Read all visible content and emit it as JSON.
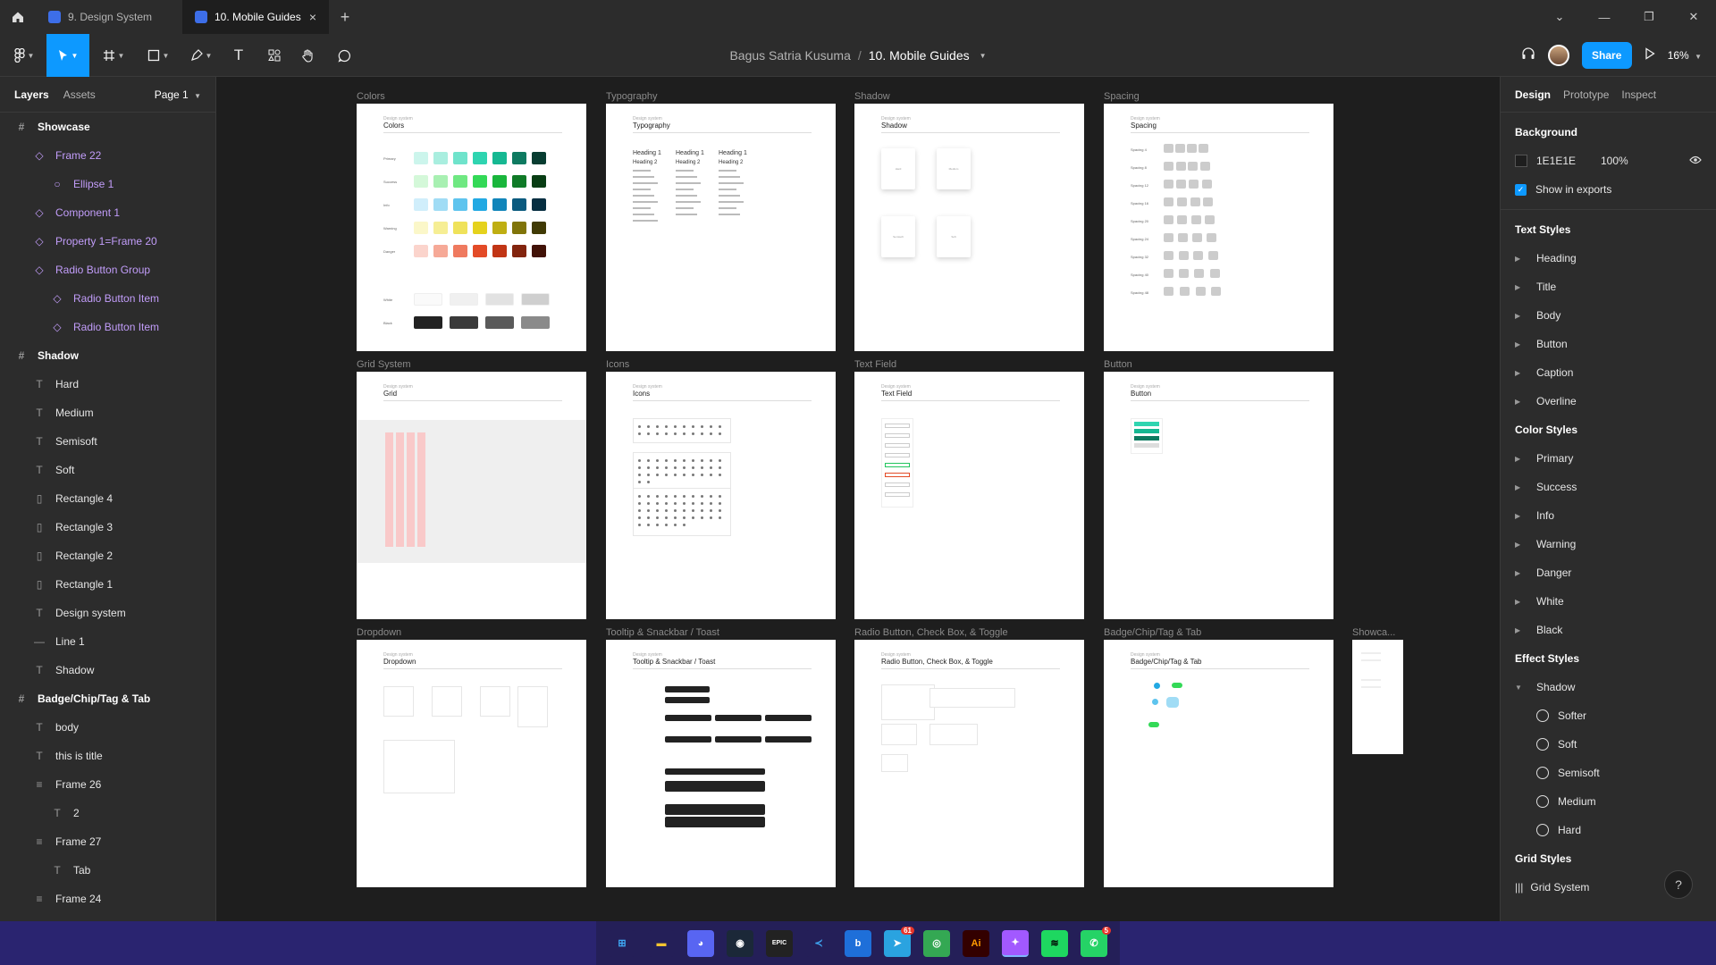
{
  "titlebar": {
    "tabs": [
      {
        "label": "9. Design System"
      },
      {
        "label": "10. Mobile Guides"
      }
    ],
    "add_tab": "+",
    "window_controls": [
      "chevron-down",
      "minimize",
      "restore",
      "close"
    ]
  },
  "toolbar": {
    "tools": [
      "main-menu",
      "move",
      "frame",
      "shape",
      "pen",
      "text",
      "resources",
      "hand",
      "comment"
    ],
    "breadcrumb": {
      "owner": "Bagus Satria Kusuma",
      "separator": "/",
      "file": "10. Mobile Guides"
    },
    "share_label": "Share",
    "zoom": "16%"
  },
  "left_panel": {
    "tabs": [
      "Layers",
      "Assets"
    ],
    "page": "Page 1",
    "layers": [
      {
        "name": "Showcase",
        "type": "frame",
        "indent": 0,
        "bold": true
      },
      {
        "name": "Frame 22",
        "type": "component",
        "indent": 1
      },
      {
        "name": "Ellipse 1",
        "type": "ellipse-comp",
        "indent": 2
      },
      {
        "name": "Component 1",
        "type": "component",
        "indent": 1
      },
      {
        "name": "Property 1=Frame 20",
        "type": "component",
        "indent": 1
      },
      {
        "name": "Radio Button Group",
        "type": "component",
        "indent": 1
      },
      {
        "name": "Radio Button Item",
        "type": "component",
        "indent": 2
      },
      {
        "name": "Radio Button Item",
        "type": "component",
        "indent": 2
      },
      {
        "name": "Shadow",
        "type": "frame",
        "indent": 0,
        "bold": true
      },
      {
        "name": "Hard",
        "type": "text",
        "indent": 1
      },
      {
        "name": "Medium",
        "type": "text",
        "indent": 1
      },
      {
        "name": "Semisoft",
        "type": "text",
        "indent": 1
      },
      {
        "name": "Soft",
        "type": "text",
        "indent": 1
      },
      {
        "name": "Rectangle 4",
        "type": "rect",
        "indent": 1
      },
      {
        "name": "Rectangle 3",
        "type": "rect",
        "indent": 1
      },
      {
        "name": "Rectangle 2",
        "type": "rect",
        "indent": 1
      },
      {
        "name": "Rectangle 1",
        "type": "rect",
        "indent": 1
      },
      {
        "name": "Design system",
        "type": "text",
        "indent": 1
      },
      {
        "name": "Line 1",
        "type": "line",
        "indent": 1
      },
      {
        "name": "Shadow",
        "type": "text",
        "indent": 1
      },
      {
        "name": "Badge/Chip/Tag & Tab",
        "type": "frame",
        "indent": 0,
        "bold": true
      },
      {
        "name": "body",
        "type": "text",
        "indent": 1
      },
      {
        "name": "this is title",
        "type": "text",
        "indent": 1
      },
      {
        "name": "Frame 26",
        "type": "autolayout",
        "indent": 1
      },
      {
        "name": "2",
        "type": "text",
        "indent": 2
      },
      {
        "name": "Frame 27",
        "type": "autolayout",
        "indent": 1
      },
      {
        "name": "Tab",
        "type": "text",
        "indent": 2
      },
      {
        "name": "Frame 24",
        "type": "autolayout",
        "indent": 1
      }
    ]
  },
  "right_panel": {
    "tabs": [
      "Design",
      "Prototype",
      "Inspect"
    ],
    "background": {
      "title": "Background",
      "hex": "1E1E1E",
      "opacity": "100%",
      "show_in_exports": "Show in exports"
    },
    "text_styles": {
      "title": "Text Styles",
      "items": [
        "Heading",
        "Title",
        "Body",
        "Button",
        "Caption",
        "Overline"
      ]
    },
    "color_styles": {
      "title": "Color Styles",
      "items": [
        "Primary",
        "Success",
        "Info",
        "Warning",
        "Danger",
        "White",
        "Black"
      ]
    },
    "effect_styles": {
      "title": "Effect Styles",
      "group": "Shadow",
      "items": [
        "Softer",
        "Soft",
        "Semisoft",
        "Medium",
        "Hard"
      ]
    },
    "grid_styles": {
      "title": "Grid Styles",
      "item": "Grid System"
    },
    "help": "?"
  },
  "canvas": {
    "frames": [
      {
        "label": "Colors",
        "title": "Colors"
      },
      {
        "label": "Typography",
        "title": "Typography"
      },
      {
        "label": "Shadow",
        "title": "Shadow"
      },
      {
        "label": "Spacing",
        "title": "Spacing"
      },
      {
        "label": "Grid System",
        "title": "Grid"
      },
      {
        "label": "Icons",
        "title": "Icons"
      },
      {
        "label": "Text Field",
        "title": "Text Field"
      },
      {
        "label": "Button",
        "title": "Button"
      },
      {
        "label": "Dropdown",
        "title": "Dropdown"
      },
      {
        "label": "Tooltip & Snackbar / Toast",
        "title": "Tooltip & Snackbar / Toast"
      },
      {
        "label": "Radio Button, Check Box, & Toggle",
        "title": "Radio Button, Check Box, & Toggle"
      },
      {
        "label": "Badge/Chip/Tag & Tab",
        "title": "Badge/Chip/Tag & Tab"
      }
    ],
    "showcase_label": "Showca...",
    "frame_subtitle": "Design system",
    "colors_rows": [
      "Primary",
      "Success",
      "Info",
      "Warning",
      "Danger",
      "White",
      "Black"
    ],
    "typography": {
      "headings": [
        "Heading 1",
        "Heading 2"
      ]
    },
    "shadow_cards": [
      "Hard",
      "Medium",
      "Semisoft",
      "Soft"
    ],
    "spacing_rows": [
      "Spacing 4",
      "Spacing 8",
      "Spacing 12",
      "Spacing 16",
      "Spacing 20",
      "Spacing 24",
      "Spacing 32",
      "Spacing 40",
      "Spacing 48"
    ]
  },
  "taskbar": {
    "apps": [
      "windows",
      "file-explorer",
      "discord",
      "steam",
      "epic-games",
      "vscode",
      "bing",
      "telegram",
      "chrome",
      "illustrator",
      "figma",
      "spotify",
      "whatsapp"
    ],
    "badges": {
      "telegram": "61",
      "whatsapp": "5"
    }
  },
  "colors": {
    "accent": "#0d99ff",
    "component": "#c29dfa",
    "panel": "#2c2c2c",
    "canvas": "#1e1e1e",
    "taskbar": "#2a2470"
  }
}
